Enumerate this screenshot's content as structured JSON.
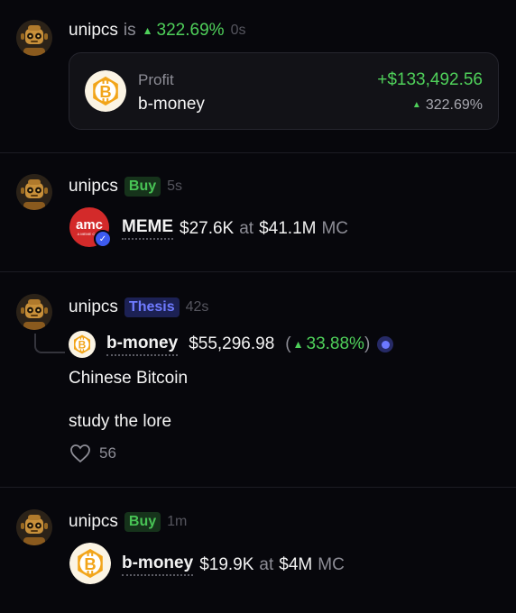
{
  "feed": [
    {
      "username": "unipcs",
      "verb": "is",
      "change": "322.69%",
      "time": "0s",
      "card": {
        "label": "Profit",
        "token": "b-money",
        "amount": "+$133,492.56",
        "pct": "322.69%"
      }
    },
    {
      "username": "unipcs",
      "badge": "Buy",
      "time": "5s",
      "token": "MEME",
      "amount": "$27.6K",
      "at_label": "at",
      "mc_value": "$41.1M",
      "mc_label": "MC",
      "coin_logo_text": "amc",
      "coin_logo_subtext": "A MEME COIN"
    },
    {
      "username": "unipcs",
      "badge": "Thesis",
      "time": "42s",
      "token": "b-money",
      "price": "$55,296.98",
      "paren_open": "(",
      "change": "33.88%",
      "paren_close": ")",
      "text_lines": [
        "Chinese Bitcoin",
        "study the lore"
      ],
      "likes": "56"
    },
    {
      "username": "unipcs",
      "badge": "Buy",
      "time": "1m",
      "token": "b-money",
      "amount": "$19.9K",
      "at_label": "at",
      "mc_value": "$4M",
      "mc_label": "MC"
    }
  ],
  "colors": {
    "background": "#07070c",
    "green": "#4fd05a",
    "buy_badge": "#16331b",
    "thesis_badge": "#1c2154",
    "coin_gold": "#f2a51a"
  }
}
